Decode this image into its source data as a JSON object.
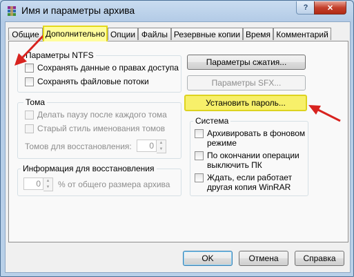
{
  "window": {
    "title": "Имя и параметры архива",
    "help_label": "?",
    "close_label": "✕"
  },
  "tabs": [
    {
      "label": "Общие"
    },
    {
      "label": "Дополнительно",
      "active": true
    },
    {
      "label": "Опции"
    },
    {
      "label": "Файлы"
    },
    {
      "label": "Резервные копии"
    },
    {
      "label": "Время"
    },
    {
      "label": "Комментарий"
    }
  ],
  "ntfs": {
    "title": "Параметры NTFS",
    "items": [
      "Сохранять данные о правах доступа",
      "Сохранять файловые потоки"
    ]
  },
  "volumes": {
    "title": "Тома",
    "items": [
      "Делать паузу после каждого тома",
      "Старый стиль именования томов"
    ],
    "recovery_label": "Томов для восстановления:",
    "recovery_value": "0"
  },
  "recovery": {
    "title": "Информация для восстановления",
    "value": "0",
    "suffix": "% от общего размера архива"
  },
  "buttons": {
    "compression": "Параметры сжатия...",
    "sfx": "Параметры SFX...",
    "password": "Установить пароль..."
  },
  "system": {
    "title": "Система",
    "items": [
      {
        "line1": "Архивировать в фоновом",
        "line2": "режиме"
      },
      {
        "line1": "По окончании операции",
        "line2": "выключить ПК"
      },
      {
        "line1": "Ждать, если работает",
        "line2": "другая копия WinRAR"
      }
    ]
  },
  "footer": {
    "ok": "OK",
    "cancel": "Отмена",
    "help": "Справка"
  },
  "colors": {
    "highlight": "#f7f06a",
    "arrow": "#d8231f"
  }
}
